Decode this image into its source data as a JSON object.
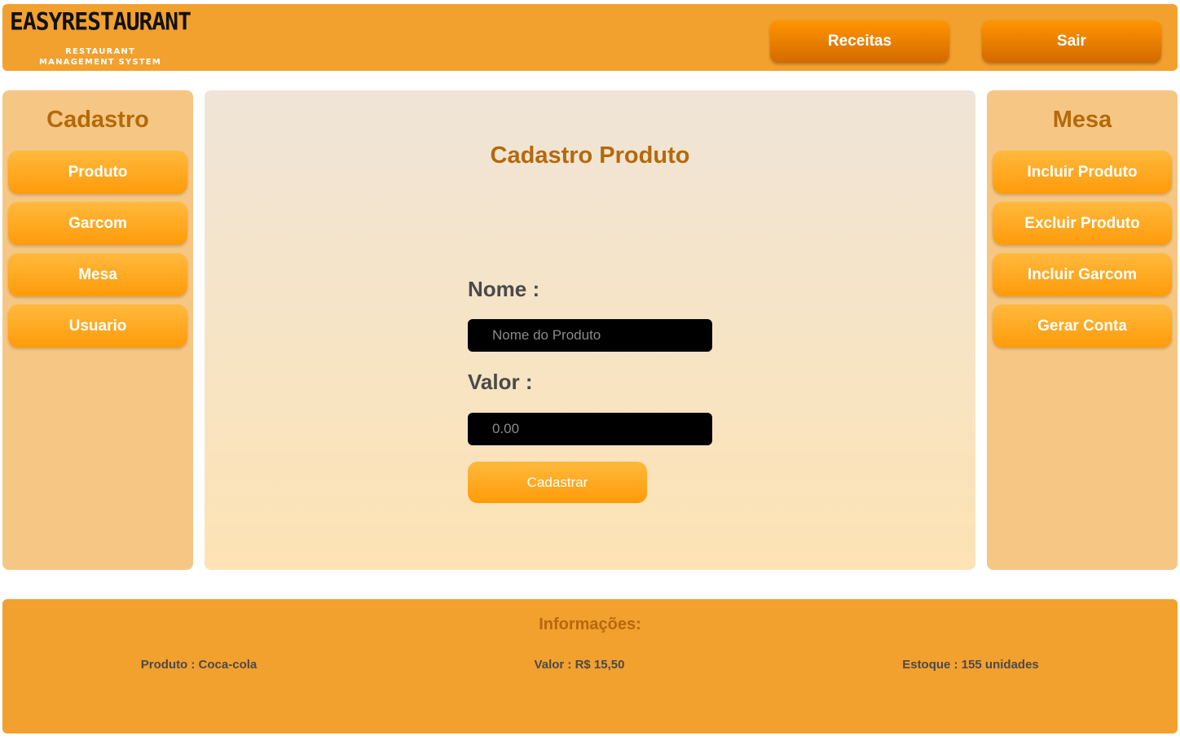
{
  "header": {
    "logo_title": "EASYRESTAURANT",
    "logo_line1": "RESTAURANT",
    "logo_line2": "MANAGEMENT SYSTEM",
    "receitas_label": "Receitas",
    "sair_label": "Sair"
  },
  "left_panel": {
    "title": "Cadastro",
    "items": [
      {
        "label": "Produto"
      },
      {
        "label": "Garcom"
      },
      {
        "label": "Mesa"
      },
      {
        "label": "Usuario"
      }
    ]
  },
  "right_panel": {
    "title": "Mesa",
    "items": [
      {
        "label": "Incluir Produto"
      },
      {
        "label": "Excluir Produto"
      },
      {
        "label": "Incluir Garcom"
      },
      {
        "label": "Gerar Conta"
      }
    ]
  },
  "form": {
    "title": "Cadastro Produto",
    "nome_label": "Nome :",
    "nome_placeholder": "Nome do Produto",
    "nome_value": "",
    "valor_label": "Valor :",
    "valor_placeholder": "0.00",
    "valor_value": "",
    "submit_label": "Cadastrar"
  },
  "footer": {
    "title": "Informações:",
    "produto": "Produto : Coca-cola",
    "valor": "Valor : R$ 15,50",
    "estoque": "Estoque : 155 unidades"
  },
  "colors": {
    "primary": "#f2a02e",
    "accent_text": "#b5690a",
    "panel": "#f6c784",
    "button_top": "#ffb93d",
    "button_bottom": "#ff9b0a",
    "header_button_top": "#ff9500",
    "header_button_bottom": "#d46a00",
    "input_bg": "#000000"
  }
}
